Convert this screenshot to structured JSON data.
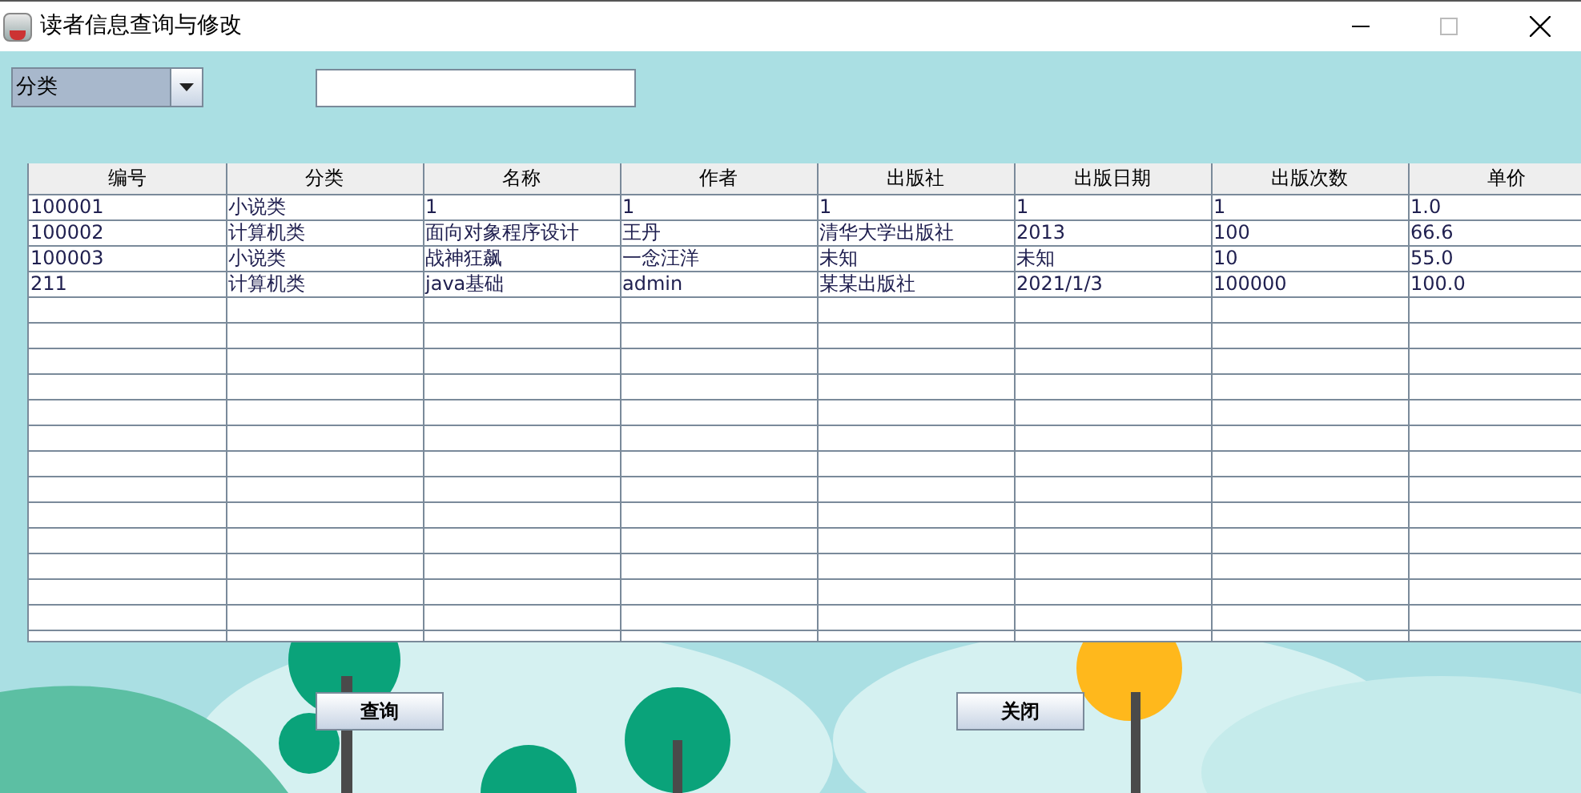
{
  "window": {
    "title": "读者信息查询与修改"
  },
  "filter": {
    "category": "分类"
  },
  "table": {
    "columns": [
      "编号",
      "分类",
      "名称",
      "作者",
      "出版社",
      "出版日期",
      "出版次数",
      "单价"
    ],
    "rows": [
      [
        "100001",
        "小说类",
        "1",
        "1",
        "1",
        "1",
        "1",
        "1.0"
      ],
      [
        "100002",
        "计算机类",
        "面向对象程序设计",
        "王丹",
        "清华大学出版社",
        "2013",
        "100",
        "66.6"
      ],
      [
        "100003",
        "小说类",
        "战神狂飙",
        "一念汪洋",
        "未知",
        "未知",
        "10",
        "55.0"
      ],
      [
        "211",
        "计算机类",
        "java基础",
        "admin",
        "某某出版社",
        "2021/1/3",
        "100000",
        "100.0"
      ]
    ]
  },
  "buttons": [
    {
      "label": "查询"
    },
    {
      "label": "关闭"
    }
  ]
}
